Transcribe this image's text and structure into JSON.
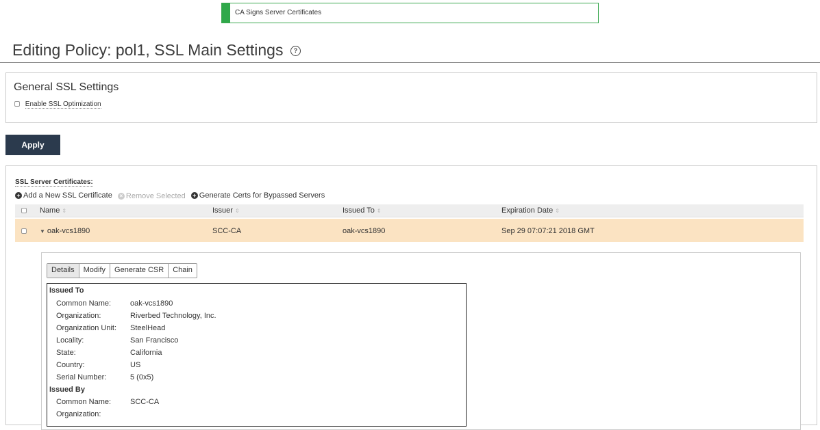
{
  "banner": {
    "text": "CA Signs Server Certificates",
    "color": "#2fa84a"
  },
  "page": {
    "title": "Editing Policy: pol1, SSL Main Settings",
    "help_icon": "?"
  },
  "general": {
    "heading": "General SSL Settings",
    "enable_label": "Enable SSL Optimization"
  },
  "apply_label": "Apply",
  "certs": {
    "label": "SSL Server Certificates:",
    "actions": {
      "add": "Add a New SSL Certificate",
      "remove": "Remove Selected",
      "generate": "Generate Certs for Bypassed Servers"
    },
    "columns": [
      "Name",
      "Issuer",
      "Issued To",
      "Expiration Date"
    ],
    "rows": [
      {
        "name": "oak-vcs1890",
        "issuer": "SCC-CA",
        "issued_to": "oak-vcs1890",
        "expiration": "Sep 29 07:07:21 2018 GMT"
      }
    ]
  },
  "detail": {
    "tabs": [
      "Details",
      "Modify",
      "Generate CSR",
      "Chain"
    ],
    "issued_to": {
      "heading": "Issued To",
      "fields": [
        {
          "key": "Common Name:",
          "value": "oak-vcs1890"
        },
        {
          "key": "Organization:",
          "value": "Riverbed Technology, Inc."
        },
        {
          "key": "Organization Unit:",
          "value": "SteelHead"
        },
        {
          "key": "Locality:",
          "value": "San Francisco"
        },
        {
          "key": "State:",
          "value": "California"
        },
        {
          "key": "Country:",
          "value": "US"
        },
        {
          "key": "Serial Number:",
          "value": "5 (0x5)"
        }
      ]
    },
    "issued_by": {
      "heading": "Issued By",
      "fields": [
        {
          "key": "Common Name:",
          "value": "SCC-CA"
        },
        {
          "key": "Organization:",
          "value": ""
        }
      ]
    }
  },
  "colors": {
    "apply_bg": "#2b3a4d",
    "selected_row": "#fbe3c2"
  }
}
